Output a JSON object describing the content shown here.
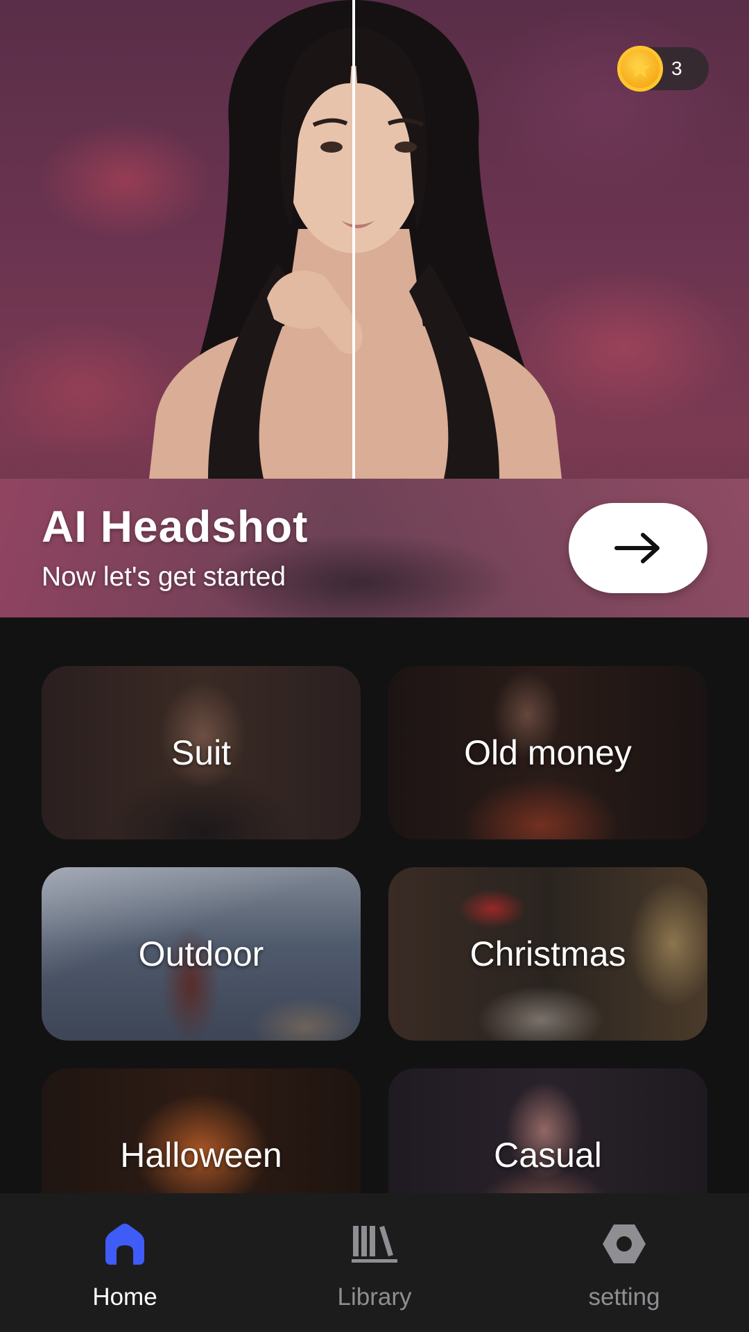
{
  "hero": {
    "title": "AI Headshot",
    "subtitle": "Now let's get started",
    "coins": "3"
  },
  "categories": [
    {
      "label": "Suit"
    },
    {
      "label": "Old money"
    },
    {
      "label": "Outdoor"
    },
    {
      "label": "Christmas"
    },
    {
      "label": "Halloween"
    },
    {
      "label": "Casual"
    }
  ],
  "nav": {
    "items": [
      {
        "label": "Home",
        "icon": "home-icon",
        "active": true
      },
      {
        "label": "Library",
        "icon": "library-icon",
        "active": false
      },
      {
        "label": "setting",
        "icon": "settings-icon",
        "active": false
      }
    ]
  },
  "colors": {
    "accent": "#3f5cf6",
    "background": "#121213",
    "coin": "#f5a713",
    "nav_background": "#1c1c1d"
  }
}
